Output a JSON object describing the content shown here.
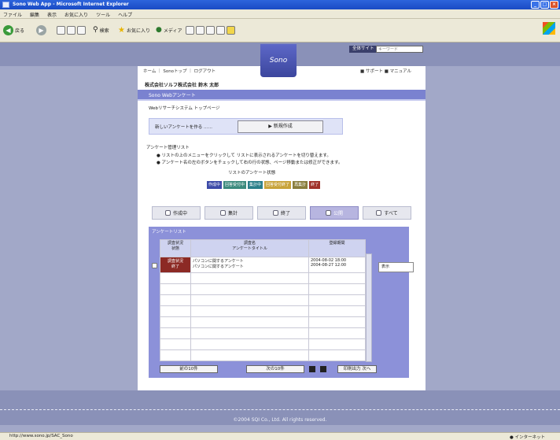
{
  "window": {
    "title": "Sono Web App - Microsoft Internet Explorer",
    "buttons": [
      "_",
      "□",
      "×"
    ]
  },
  "menu": [
    "ファイル",
    "編集",
    "表示",
    "お気に入り",
    "ツール",
    "ヘルプ"
  ],
  "toolbar": {
    "back": "戻る",
    "search": "検索",
    "favorites": "お気に入り",
    "media": "メディア"
  },
  "header": {
    "search_label": "全体サイト",
    "search_placeholder": "キーワード",
    "logo": "Sono"
  },
  "nav": {
    "crumbs": [
      "ホーム",
      "Sonoトップ",
      "ログアウト"
    ],
    "right": [
      "■ サポート",
      "■ マニュアル"
    ],
    "company": "株式会社ソルフ株式会社 鈴木 太郎"
  },
  "section": {
    "title": "Sono Webアンケート",
    "subtitle": "Webリサーチシステム トップページ"
  },
  "create": {
    "label": "新しいアンケートを作る ……",
    "button": "新規作成"
  },
  "list": {
    "title": "アンケート管理リスト",
    "notes": [
      "● リストの上のメニューをクリックして リストに表示されるアンケートを切り替えます。",
      "● アンケート名の左のボタンをチェックして右の行の状態、ページ移動または修正ができます。"
    ],
    "color_title": "リストのアンケート状態",
    "legend": [
      {
        "label": "作成中",
        "color": "#3c4aa8"
      },
      {
        "label": "回答受付中",
        "color": "#3b8a7d"
      },
      {
        "label": "集計中",
        "color": "#2a7f8a"
      },
      {
        "label": "回答受付終了",
        "color": "#c8a33a"
      },
      {
        "label": "再集計",
        "color": "#8a7d3c"
      },
      {
        "label": "終了",
        "color": "#a0322a"
      }
    ]
  },
  "tabs": [
    "作成中",
    "集計",
    "終了",
    "公開",
    "すべて"
  ],
  "panel": {
    "title": "アンケートリスト"
  },
  "table": {
    "headers": [
      "調査状況\n状態",
      "調査名\nアンケートタイトル",
      "登録期間"
    ],
    "row": {
      "status": "調査状況\n終了",
      "title": "パソコンに関するアンケート\nパソコンに関するアンケート",
      "period": "2004-08-02 18:00\n2004-08-27 12:00"
    },
    "side_value": "表示"
  },
  "buttons": {
    "first": "前の10件",
    "next": "次の10件",
    "print": "印刷出力 次へ"
  },
  "footer": {
    "copyright": "©2004 SQI Co., Ltd. All rights reserved."
  },
  "status": {
    "url": "http://www.sono.jp/SAC_Sono",
    "zone": "インターネット"
  }
}
